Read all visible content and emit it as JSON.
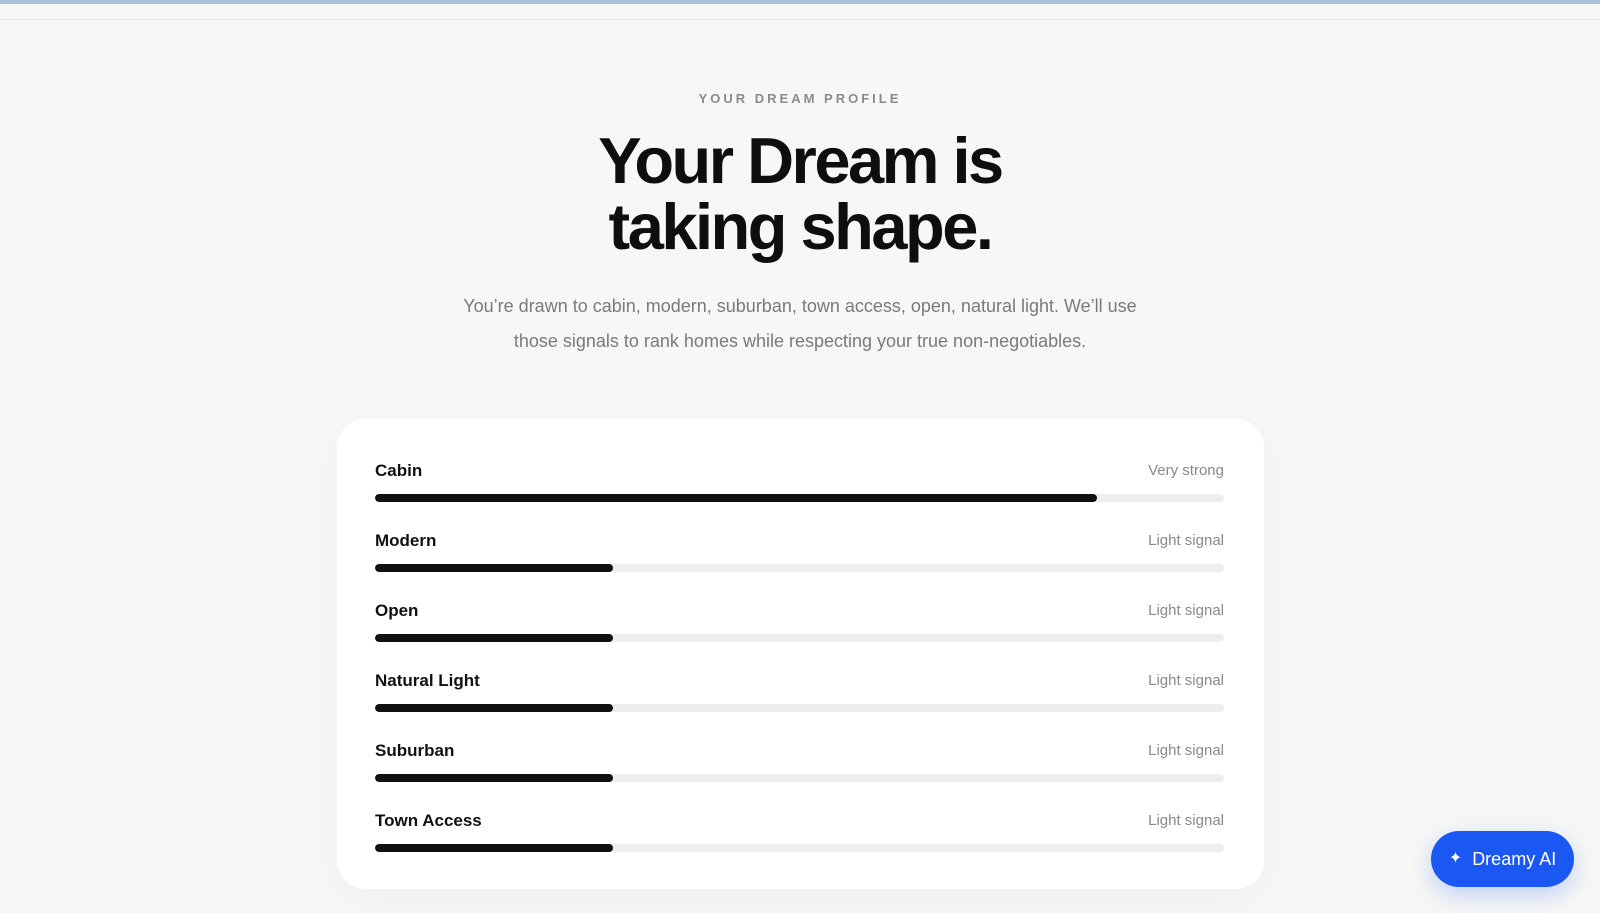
{
  "header": {
    "eyebrow": "YOUR DREAM PROFILE",
    "title_line1": "Your Dream is",
    "title_line2": "taking shape.",
    "description": "You’re drawn to cabin, modern, suburban, town access, open, natural light. We’ll use those signals to rank homes while respecting your true non-negotiables."
  },
  "signals": [
    {
      "name": "Cabin",
      "strength": "Very strong",
      "level": 0.85
    },
    {
      "name": "Modern",
      "strength": "Light signal",
      "level": 0.28
    },
    {
      "name": "Open",
      "strength": "Light signal",
      "level": 0.28
    },
    {
      "name": "Natural Light",
      "strength": "Light signal",
      "level": 0.28
    },
    {
      "name": "Suburban",
      "strength": "Light signal",
      "level": 0.28
    },
    {
      "name": "Town Access",
      "strength": "Light signal",
      "level": 0.28
    }
  ],
  "assistant": {
    "label": "Dreamy AI",
    "icon": "sparkle-icon"
  },
  "colors": {
    "accent": "#1b57f2",
    "bar_fill": "#111111",
    "bar_track": "#eeeeee",
    "background": "#f7f7f5"
  }
}
